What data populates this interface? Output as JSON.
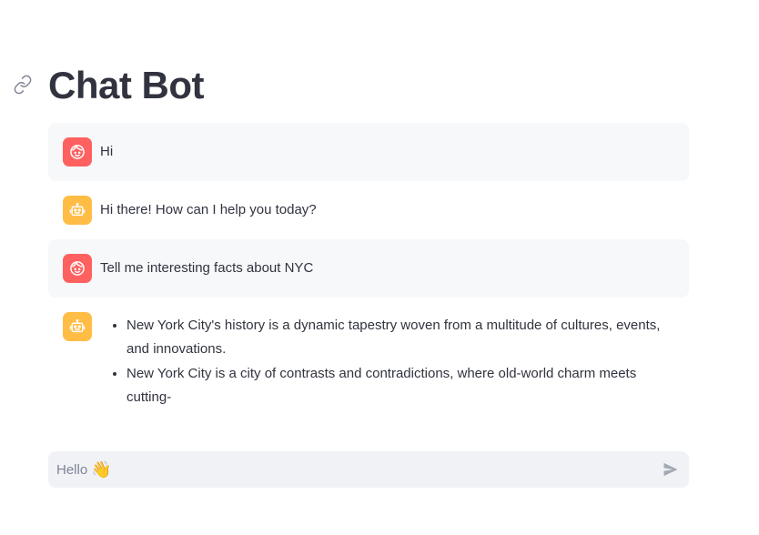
{
  "header": {
    "title": "Chat Bot",
    "link_icon": "link-icon"
  },
  "messages": [
    {
      "role": "user",
      "avatar_icon": "user-face-icon",
      "text": "Hi"
    },
    {
      "role": "assistant",
      "avatar_icon": "robot-icon",
      "text": "Hi there! How can I help you today?"
    },
    {
      "role": "user",
      "avatar_icon": "user-face-icon",
      "text": "Tell me interesting facts about NYC"
    },
    {
      "role": "assistant",
      "avatar_icon": "robot-icon",
      "items": [
        "New York City's history is a dynamic tapestry woven from a multitude of cultures, events, and innovations.",
        "New York City is a city of contrasts and contradictions, where old-world charm meets cutting-"
      ]
    }
  ],
  "input": {
    "placeholder": "Hello",
    "placeholder_emoji": "👋",
    "send_icon": "send-icon"
  },
  "colors": {
    "user_avatar": "#ff6060",
    "assistant_avatar": "#ffbd45",
    "user_bubble": "#f7f8fa",
    "input_bg": "#f0f2f6",
    "text": "#31333f"
  }
}
